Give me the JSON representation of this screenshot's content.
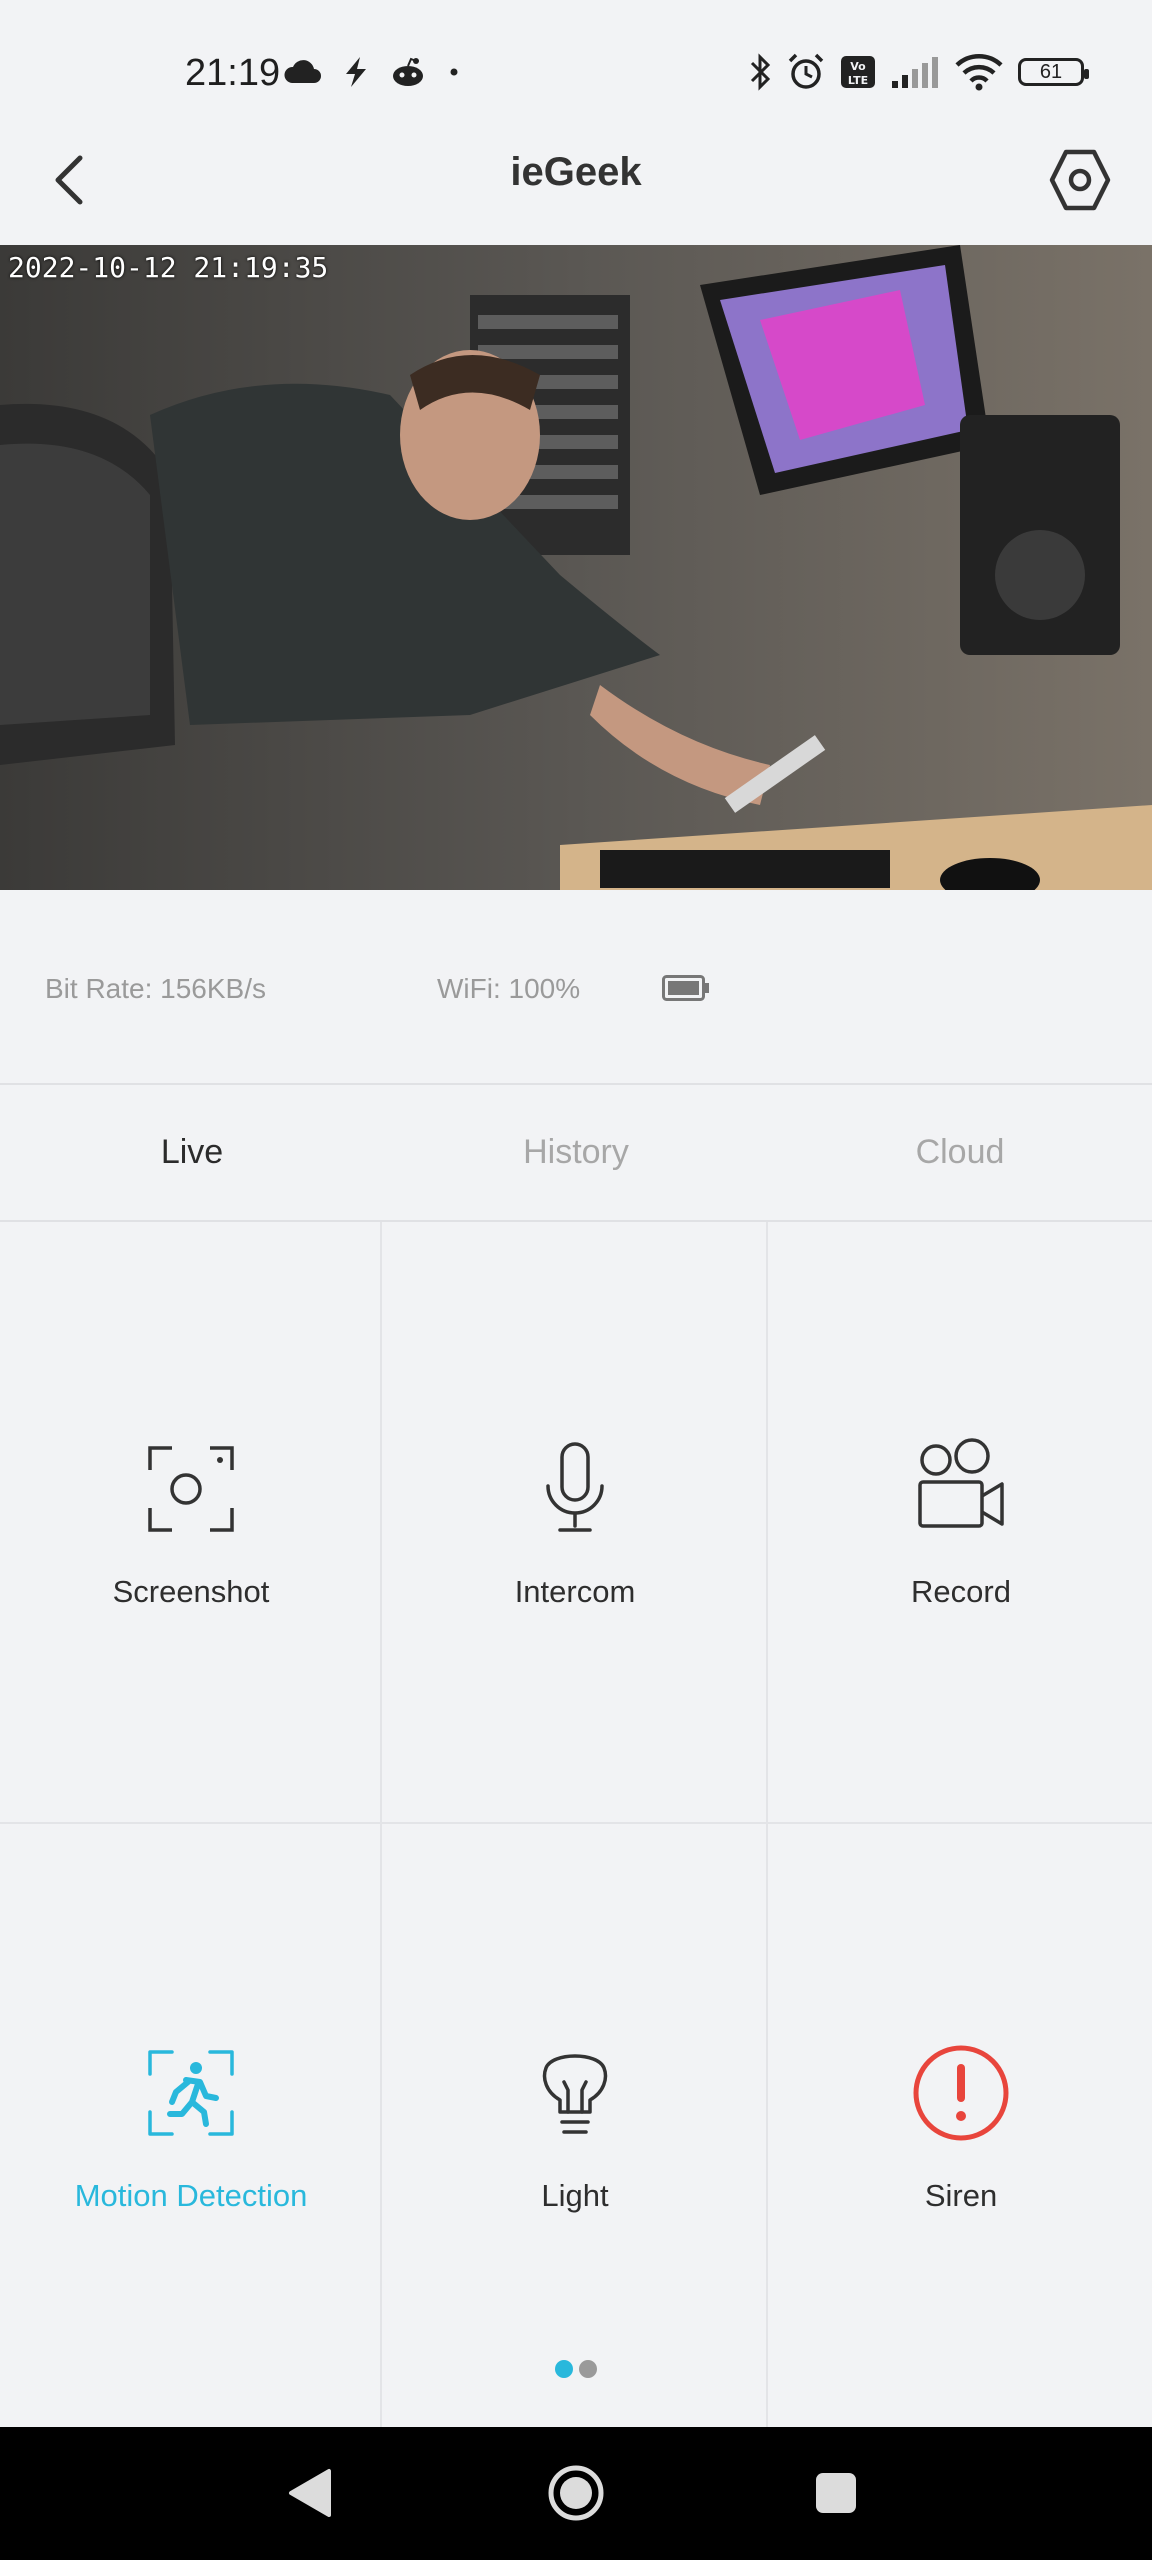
{
  "status_bar": {
    "time": "21:19",
    "battery_level": "61",
    "left_icons": [
      "cloud-icon",
      "flash-icon",
      "reddit-icon",
      "dot-icon"
    ],
    "right_icons": [
      "bluetooth-icon",
      "alarm-icon",
      "volte-icon",
      "signal-icon",
      "wifi-icon",
      "battery-icon"
    ]
  },
  "header": {
    "title": "ieGeek",
    "back_icon": "chevron-left-icon",
    "settings_icon": "hexagon-settings-icon"
  },
  "video": {
    "timestamp": "2022-10-12 21:19:35"
  },
  "stats": {
    "bitrate": "Bit Rate:  156KB/s",
    "wifi": "WiFi:  100%"
  },
  "tabs": [
    {
      "label": "Live",
      "active": true
    },
    {
      "label": "History",
      "active": false
    },
    {
      "label": "Cloud",
      "active": false
    }
  ],
  "controls": [
    {
      "label": "Screenshot",
      "icon": "screenshot-icon"
    },
    {
      "label": "Intercom",
      "icon": "microphone-icon"
    },
    {
      "label": "Record",
      "icon": "video-camera-icon"
    },
    {
      "label": "Motion Detection",
      "icon": "motion-detection-icon",
      "accent": "#29b8dc"
    },
    {
      "label": "Light",
      "icon": "lightbulb-icon"
    },
    {
      "label": "Siren",
      "icon": "siren-alert-icon",
      "accent": "#e8453c"
    }
  ],
  "pagination": {
    "pages": 2,
    "current": 1
  },
  "colors": {
    "accent": "#29b8dc",
    "danger": "#e8453c",
    "background": "#f2f3f5"
  }
}
